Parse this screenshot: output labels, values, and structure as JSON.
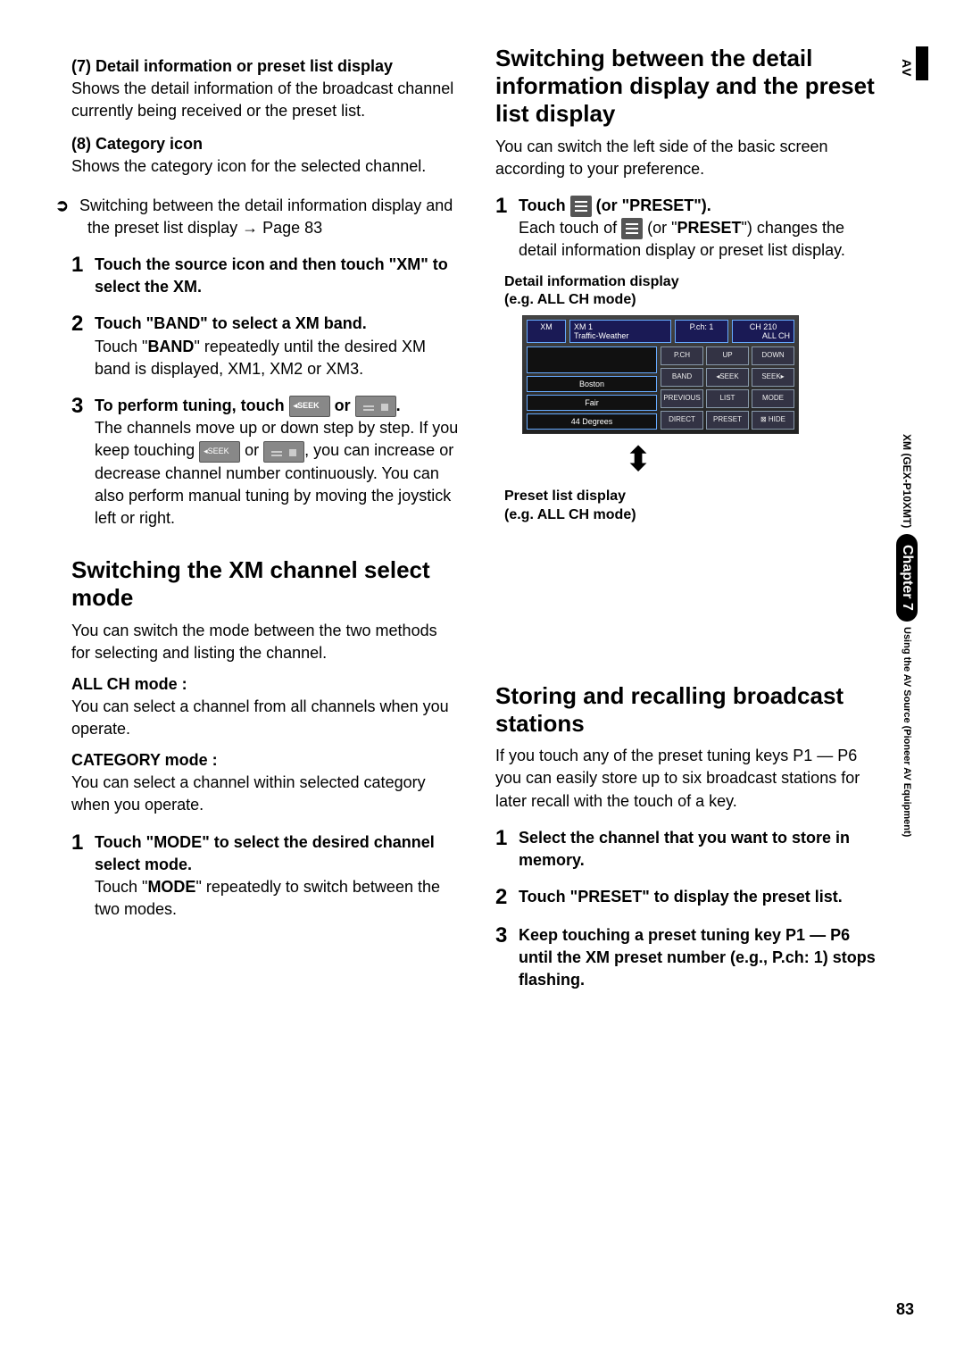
{
  "left": {
    "h7": "(7) Detail information or preset list display",
    "p7": "Shows the detail information of the broadcast channel currently being received or the preset list.",
    "h8": "(8) Category icon",
    "p8": "Shows the category icon for the selected channel.",
    "xref_icon": "➲",
    "xref_text": "Switching between the detail information display and the preset list display ",
    "xref_arrow": "→",
    "xref_page": " Page 83",
    "s1_lead": "Touch the source icon and then touch \"XM\" to select the XM.",
    "s2_lead": "Touch \"BAND\" to select a XM band.",
    "s2_body_a": "Touch \"",
    "s2_body_b": "BAND",
    "s2_body_c": "\" repeatedly until the desired XM band is displayed, XM1, XM2 or XM3.",
    "s3_lead_a": "To perform tuning, touch ",
    "s3_lead_b": " or ",
    "s3_lead_c": ".",
    "s3_body_a": "The channels move up or down step by step. If you keep touching ",
    "s3_body_b": " or ",
    "s3_body_c": ", you can increase or decrease channel number continuously. You can also perform manual tuning by moving the joystick left or right.",
    "sec1_title": "Switching the XM channel select mode",
    "sec1_intro": "You can switch the mode between the two methods for selecting and listing the channel.",
    "allch_h": "ALL CH mode :",
    "allch_p": "You can select a channel from all channels when you operate.",
    "cat_h": "CATEGORY mode :",
    "cat_p": "You can select a channel within selected category when you operate.",
    "sec1_s1_lead": "Touch \"MODE\" to select the desired channel select mode.",
    "sec1_s1_body_a": "Touch \"",
    "sec1_s1_body_b": "MODE",
    "sec1_s1_body_c": "\" repeatedly to switch between the two modes."
  },
  "right": {
    "sec2_title": "Switching between the detail information display and the preset list display",
    "sec2_intro": "You can switch the left side of the basic screen according to your preference.",
    "s1_lead_a": "Touch ",
    "s1_lead_b": " (or \"PRESET\").",
    "s1_body_a": "Each touch of ",
    "s1_body_b": " (or \"",
    "s1_body_c": "PRESET",
    "s1_body_d": "\") changes the detail information display or preset list display.",
    "cap1a": "Detail information display",
    "cap1b": "(e.g. ALL CH mode)",
    "cap2a": "Preset list display",
    "cap2b": "(e.g. ALL CH mode)",
    "sec3_title": "Storing and recalling broadcast stations",
    "sec3_intro": "If you touch any of the preset tuning keys P1 — P6 you can easily store up to six broadcast stations for later recall with the touch of a key.",
    "s3a_lead": "Select the channel that you want to store in memory.",
    "s3b_lead": "Touch \"PRESET\" to display the preset list.",
    "s3c_lead": "Keep touching a preset tuning key P1 — P6 until the XM preset number (e.g., P.ch: 1) stops flashing."
  },
  "screenshot": {
    "xm_icon": "XM",
    "xm1": "XM 1",
    "traffic": "Traffic-Weather",
    "pch": "P.ch: 1",
    "ch": "CH 210",
    "allch": "ALL CH",
    "info1": " ",
    "info2": "Boston",
    "info3": "Fair",
    "info4": "44 Degrees",
    "btns": [
      "P.CH",
      "UP",
      "DOWN",
      "BAND",
      "◂SEEK",
      "SEEK▸",
      "PREVIOUS",
      "LIST",
      "MODE",
      "DIRECT",
      "PRESET",
      "⊠ HIDE"
    ]
  },
  "side": {
    "av": "AV",
    "xm": "XM (GEX-P10XMT)",
    "chapter": "Chapter 7",
    "using": "Using the AV Source (Pioneer AV Equipment)"
  },
  "page_num": "83"
}
